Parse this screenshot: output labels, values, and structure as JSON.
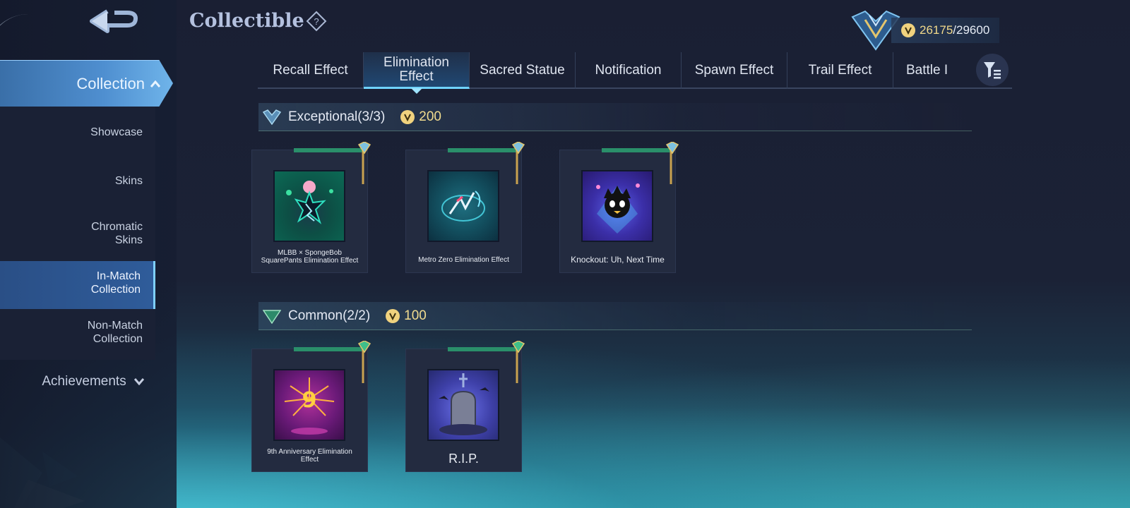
{
  "header": {
    "title": "Collectible",
    "points_current": "26175",
    "points_separator": "/",
    "points_max": "29600"
  },
  "sidebar": {
    "collection_label": "Collection",
    "items": [
      {
        "label_lines": [
          "Showcase"
        ]
      },
      {
        "label_lines": [
          "Skins"
        ]
      },
      {
        "label_lines": [
          "Chromatic",
          "Skins"
        ]
      },
      {
        "label_lines": [
          "In-Match",
          "Collection"
        ],
        "active": true
      },
      {
        "label_lines": [
          "Non-Match",
          "Collection"
        ]
      }
    ],
    "achievements_label": "Achievements"
  },
  "tabs": [
    {
      "label_lines": [
        "Recall Effect"
      ]
    },
    {
      "label_lines": [
        "Elimination",
        "Effect"
      ],
      "active": true
    },
    {
      "label_lines": [
        "Sacred Statue"
      ]
    },
    {
      "label_lines": [
        "Notification"
      ]
    },
    {
      "label_lines": [
        "Spawn Effect"
      ]
    },
    {
      "label_lines": [
        "Trail Effect"
      ]
    },
    {
      "label_lines": [
        "Battle I"
      ]
    }
  ],
  "sections": [
    {
      "title": "Exceptional(3/3)",
      "cost": "200",
      "items": [
        {
          "name_lines": [
            "MLBB × SpongeBob",
            "SquarePants Elimination Effect"
          ]
        },
        {
          "name_lines": [
            "Metro Zero Elimination Effect"
          ]
        },
        {
          "name_lines": [
            "Knockout: Uh, Next Time"
          ]
        }
      ]
    },
    {
      "title": "Common(2/2)",
      "cost": "100",
      "items": [
        {
          "name_lines": [
            "9th Anniversary Elimination",
            "Effect"
          ]
        },
        {
          "name_lines": [
            "R.I.P."
          ]
        }
      ]
    }
  ],
  "colors": {
    "accent": "#6fd3ff",
    "gold": "#f0d27e",
    "collection_tab": "#4f8fd0"
  },
  "icons": {
    "back": "back-arrow-icon",
    "help": "question-diamond-icon",
    "rank": "rank-badge-icon",
    "coin": "coin-icon",
    "filter": "filter-icon",
    "tier_exceptional": "tier-diamond-icon",
    "tier_common": "tier-triangle-icon",
    "collapse": "chevron-up-icon",
    "expand": "chevron-down-icon"
  }
}
